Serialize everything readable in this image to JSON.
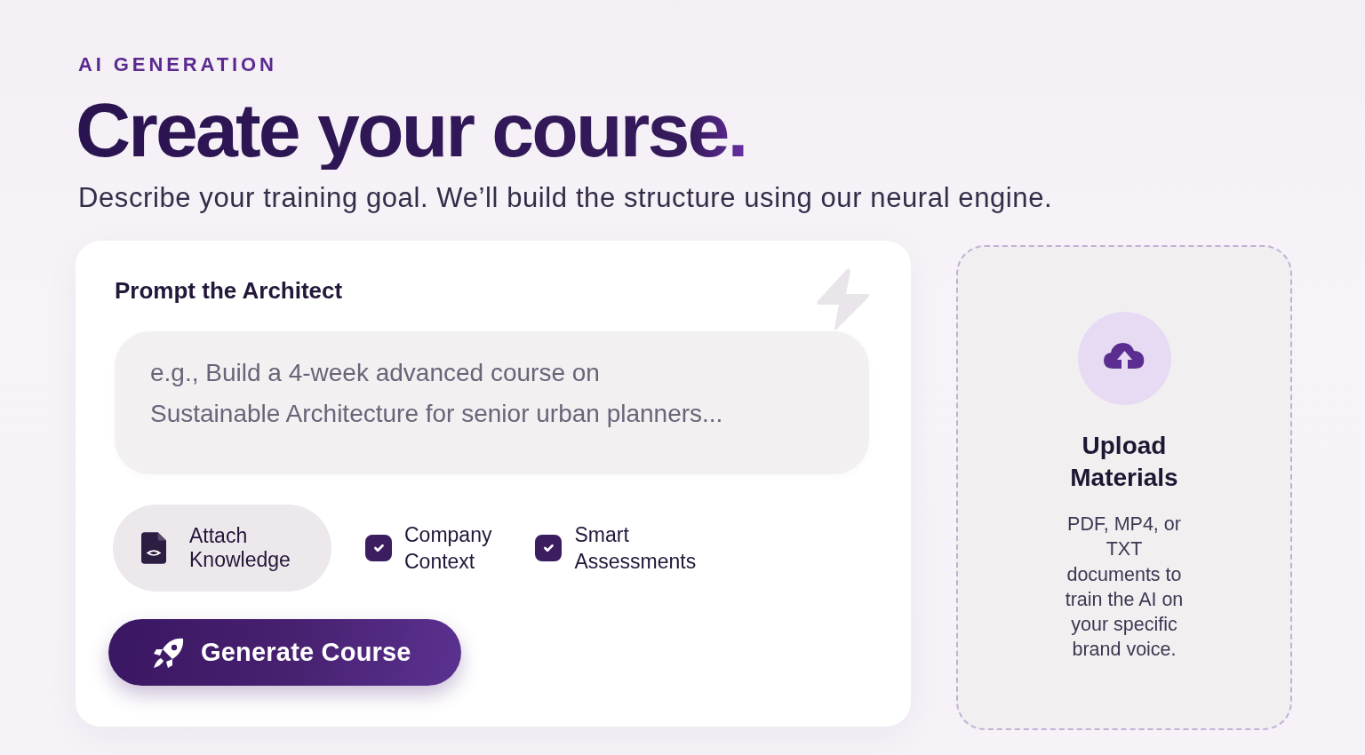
{
  "header": {
    "eyebrow": "AI GENERATION",
    "title": "Create your course.",
    "subtitle": "Describe your training goal. We’ll build the structure using our neural engine."
  },
  "prompt_card": {
    "title": "Prompt the Architect",
    "prompt_field": {
      "placeholder": "e.g., Build a 4-week advanced course on Sustainable Architecture for senior urban planners..."
    },
    "attach_button": "Attach Knowledge",
    "options": [
      {
        "label": "Company Context",
        "checked": true
      },
      {
        "label": "Smart Assessments",
        "checked": true
      }
    ],
    "generate_button": "Generate Course"
  },
  "upload_card": {
    "title": "Upload Materials",
    "description": "PDF, MP4, or TXT documents to train the AI on your specific brand voice."
  }
}
